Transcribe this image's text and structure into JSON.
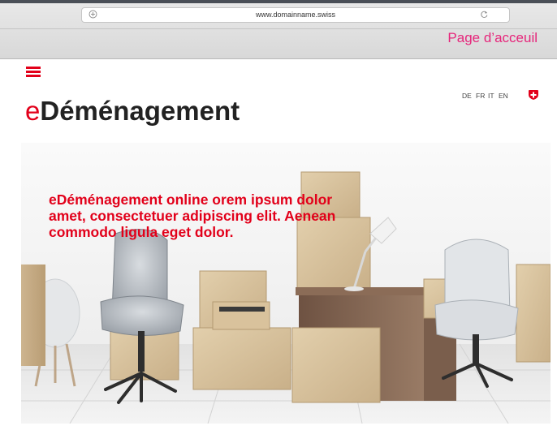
{
  "browser": {
    "url": "www.domainname.swiss",
    "page_label": "Page d’acceuil"
  },
  "header": {
    "brand_prefix": "e",
    "brand_main": "Déménagement",
    "languages": [
      "DE",
      "FR",
      "IT",
      "EN"
    ]
  },
  "hero": {
    "headline_lines": [
      "eDéménagement online orem ipsum dolor",
      "amet, consectetuer adipiscing elit. Aenean",
      "commodo ligula eget dolor."
    ]
  },
  "colors": {
    "brand_red": "#e2001a",
    "page_label_pink": "#e6267b"
  },
  "icons": [
    "add-tab-icon",
    "reload-icon",
    "hamburger-menu-icon",
    "swiss-flag-icon"
  ]
}
